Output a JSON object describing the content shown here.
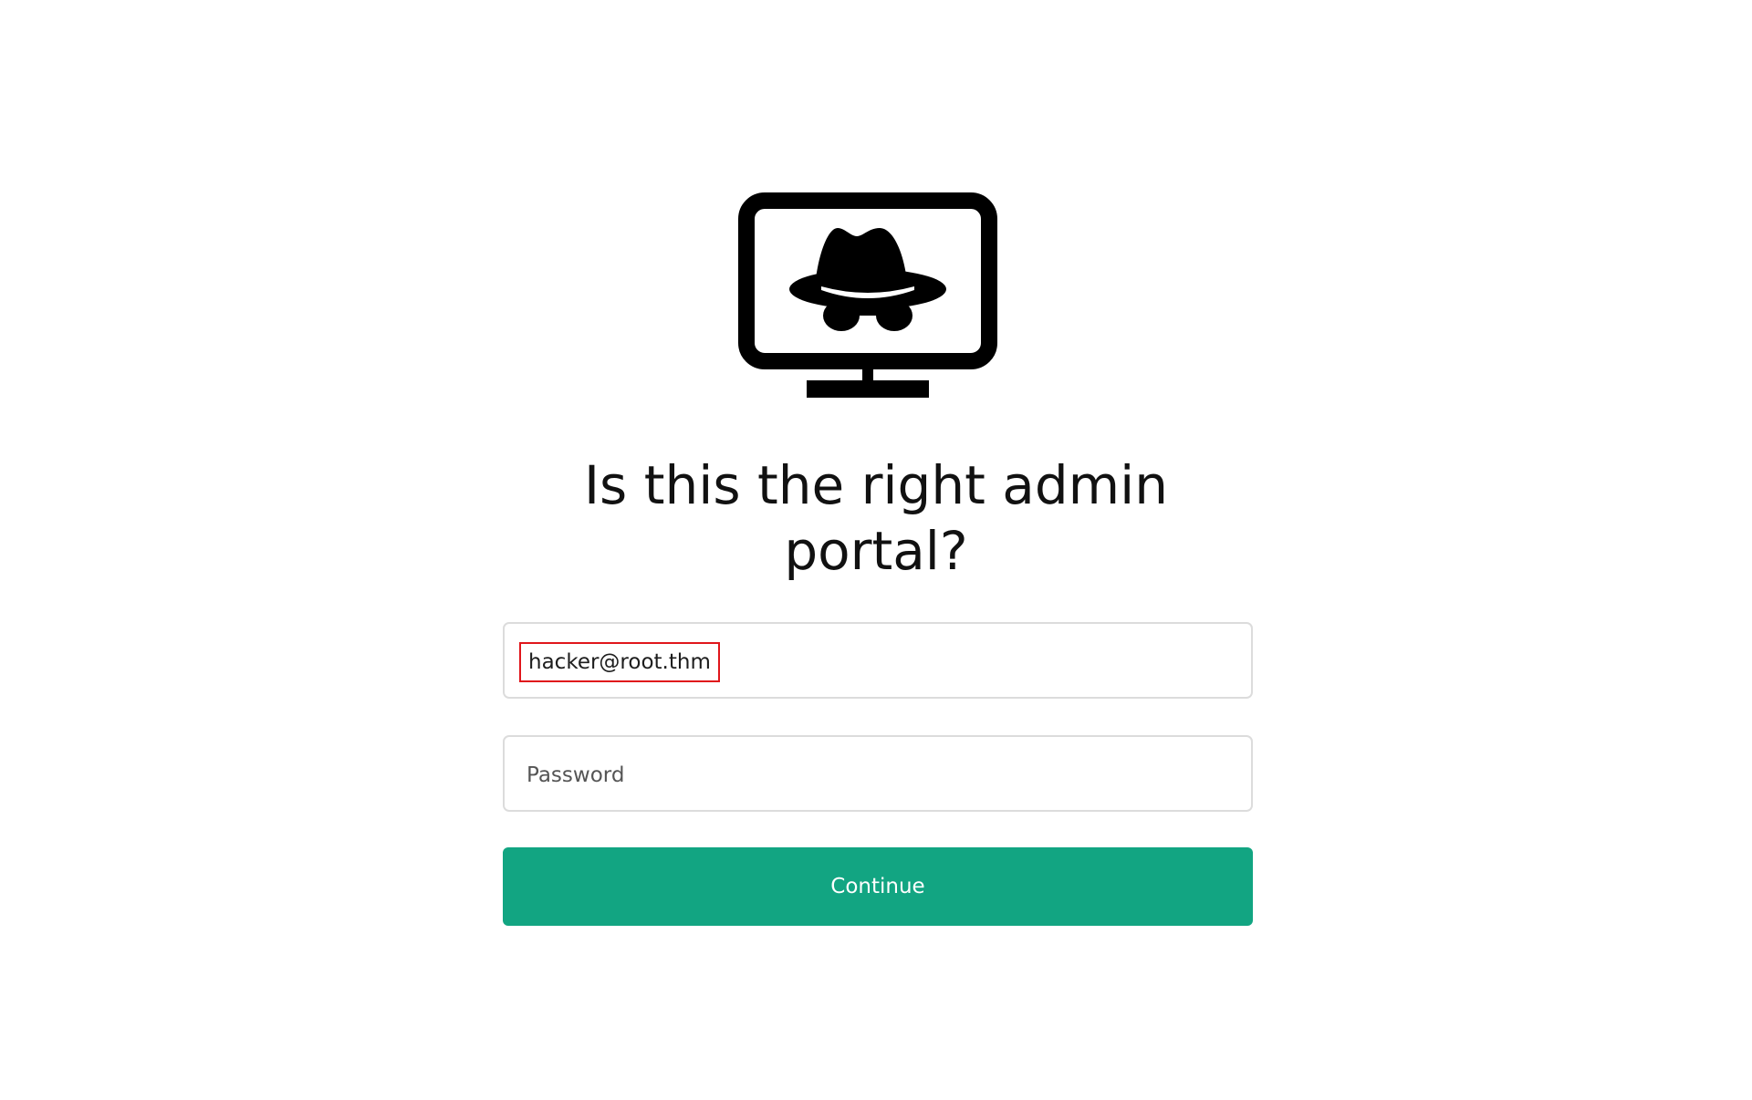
{
  "logo": {
    "icon": "monitor-hacker-icon"
  },
  "heading": "Is this the right admin portal?",
  "form": {
    "email": {
      "value": "hacker@root.thm"
    },
    "password": {
      "placeholder": "Password"
    },
    "continue_label": "Continue"
  },
  "colors": {
    "accent": "#12a582",
    "highlight_box": "#e0161b",
    "border": "#dcdcdc",
    "text": "#111111"
  }
}
